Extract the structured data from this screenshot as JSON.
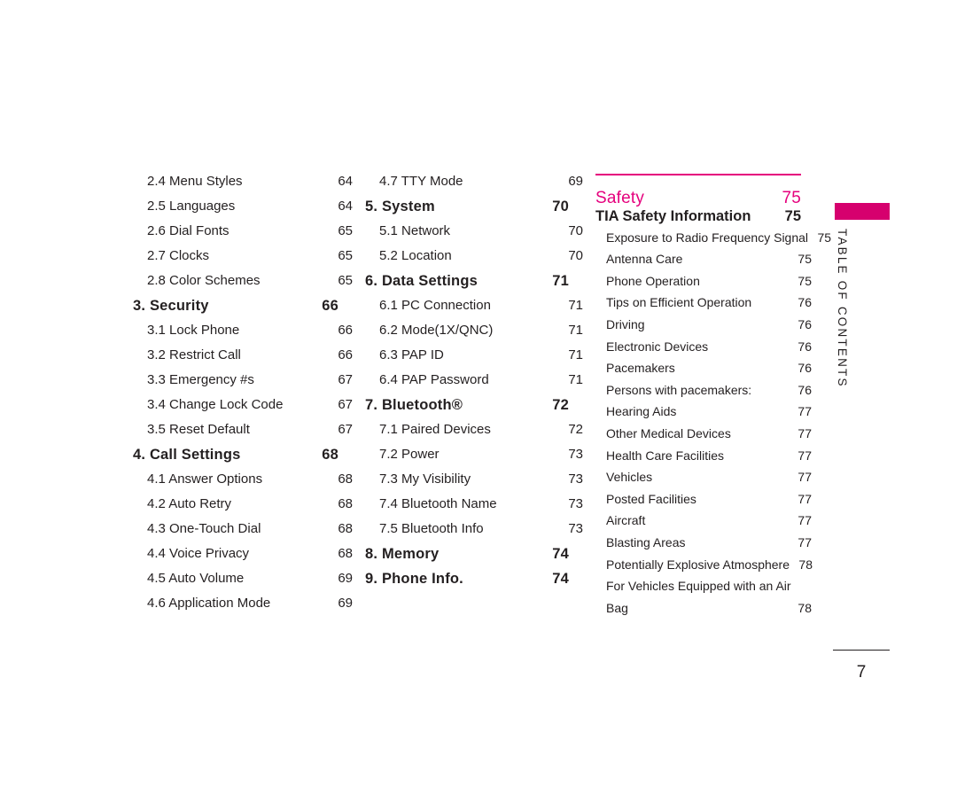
{
  "document": {
    "section_tab_label": "TABLE OF CONTENTS",
    "page_number": "7",
    "accent_color": "#d6006e",
    "heading_color": "#e5007d"
  },
  "columns": [
    {
      "id": "column-1",
      "rows": [
        {
          "level": "sub",
          "label": "2.4 Menu Styles",
          "page": "64"
        },
        {
          "level": "sub",
          "label": "2.5 Languages",
          "page": "64"
        },
        {
          "level": "sub",
          "label": "2.6 Dial Fonts",
          "page": "65"
        },
        {
          "level": "sub",
          "label": "2.7 Clocks",
          "page": "65"
        },
        {
          "level": "sub",
          "label": "2.8 Color Schemes",
          "page": "65"
        },
        {
          "level": "head",
          "label": "3. Security",
          "page": "66"
        },
        {
          "level": "sub",
          "label": "3.1 Lock Phone",
          "page": "66"
        },
        {
          "level": "sub",
          "label": "3.2 Restrict Call",
          "page": "66"
        },
        {
          "level": "sub",
          "label": "3.3 Emergency #s",
          "page": "67"
        },
        {
          "level": "sub",
          "label": "3.4 Change Lock Code",
          "page": "67"
        },
        {
          "level": "sub",
          "label": "3.5 Reset Default",
          "page": "67"
        },
        {
          "level": "head",
          "label": "4. Call Settings",
          "page": "68"
        },
        {
          "level": "sub",
          "label": "4.1 Answer Options",
          "page": "68"
        },
        {
          "level": "sub",
          "label": "4.2 Auto Retry",
          "page": "68"
        },
        {
          "level": "sub",
          "label": "4.3 One-Touch Dial",
          "page": "68"
        },
        {
          "level": "sub",
          "label": "4.4 Voice Privacy",
          "page": "68"
        },
        {
          "level": "sub",
          "label": "4.5 Auto Volume",
          "page": "69"
        },
        {
          "level": "sub",
          "label": "4.6 Application Mode",
          "page": "69"
        }
      ]
    },
    {
      "id": "column-2",
      "rows": [
        {
          "level": "sub",
          "label": "4.7 TTY Mode",
          "page": "69"
        },
        {
          "level": "head",
          "label": "5. System",
          "page": "70"
        },
        {
          "level": "sub",
          "label": "5.1 Network",
          "page": "70"
        },
        {
          "level": "sub",
          "label": "5.2 Location",
          "page": "70"
        },
        {
          "level": "head",
          "label": "6. Data Settings",
          "page": "71"
        },
        {
          "level": "sub",
          "label": "6.1 PC Connection",
          "page": "71"
        },
        {
          "level": "sub",
          "label": "6.2 Mode(1X/QNC)",
          "page": "71"
        },
        {
          "level": "sub",
          "label": "6.3 PAP ID",
          "page": "71"
        },
        {
          "level": "sub",
          "label": "6.4 PAP Password",
          "page": "71"
        },
        {
          "level": "head",
          "label": "7. Bluetooth®",
          "page": "72"
        },
        {
          "level": "sub",
          "label": "7.1 Paired Devices",
          "page": "72"
        },
        {
          "level": "sub",
          "label": "7.2 Power",
          "page": "73"
        },
        {
          "level": "sub",
          "label": "7.3 My Visibility",
          "page": "73"
        },
        {
          "level": "sub",
          "label": "7.4 Bluetooth Name",
          "page": "73"
        },
        {
          "level": "sub",
          "label": "7.5 Bluetooth Info",
          "page": "73"
        },
        {
          "level": "head",
          "label": "8. Memory",
          "page": "74"
        },
        {
          "level": "head",
          "label": "9. Phone Info.",
          "page": "74"
        }
      ]
    },
    {
      "id": "column-3",
      "group_title": "Safety",
      "group_page": "75",
      "rows": [
        {
          "level": "head",
          "label": "TIA Safety Information",
          "page": "75"
        },
        {
          "level": "sub",
          "label": "Exposure to Radio Frequency Signal",
          "page": "75"
        },
        {
          "level": "sub",
          "label": "Antenna Care",
          "page": "75"
        },
        {
          "level": "sub",
          "label": "Phone Operation",
          "page": "75"
        },
        {
          "level": "sub",
          "label": "Tips on Efficient Operation",
          "page": "76"
        },
        {
          "level": "sub",
          "label": "Driving",
          "page": "76"
        },
        {
          "level": "sub",
          "label": "Electronic Devices",
          "page": "76"
        },
        {
          "level": "sub",
          "label": "Pacemakers",
          "page": "76"
        },
        {
          "level": "sub",
          "label": "Persons with pacemakers:",
          "page": "76"
        },
        {
          "level": "sub",
          "label": "Hearing Aids",
          "page": "77"
        },
        {
          "level": "sub",
          "label": "Other Medical Devices",
          "page": "77"
        },
        {
          "level": "sub",
          "label": "Health Care Facilities",
          "page": "77"
        },
        {
          "level": "sub",
          "label": "Vehicles",
          "page": "77"
        },
        {
          "level": "sub",
          "label": "Posted Facilities",
          "page": "77"
        },
        {
          "level": "sub",
          "label": "Aircraft",
          "page": "77"
        },
        {
          "level": "sub",
          "label": "Blasting Areas",
          "page": "77"
        },
        {
          "level": "sub",
          "label": "Potentially Explosive Atmosphere",
          "page": "78"
        },
        {
          "level": "sub",
          "label": "For Vehicles Equipped with an Air",
          "page": ""
        },
        {
          "level": "sub",
          "label": "Bag",
          "page": "78"
        }
      ]
    }
  ]
}
